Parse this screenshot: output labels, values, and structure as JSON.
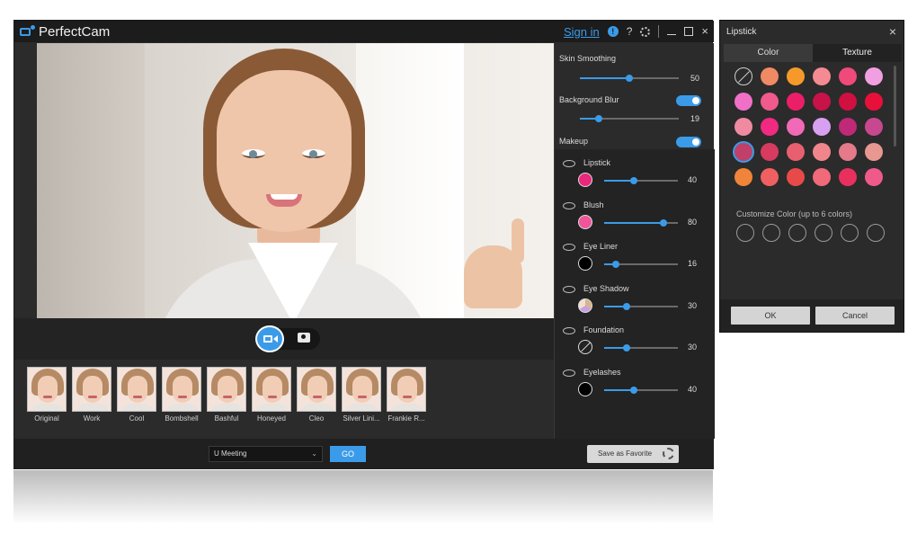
{
  "app": {
    "name": "PerfectCam",
    "signin_label": "Sign in",
    "help_label": "?",
    "close_label": "×"
  },
  "settings": {
    "skin_smoothing": {
      "label": "Skin Smoothing",
      "value": "50",
      "level": 50
    },
    "background_blur": {
      "label": "Background Blur",
      "value": "19",
      "level": 19,
      "enabled": true
    },
    "makeup": {
      "label": "Makeup",
      "enabled": true
    }
  },
  "makeup_items": [
    {
      "label": "Lipstick",
      "value": "40",
      "level": 40,
      "color": "#e8287a",
      "icon": "lips-icon"
    },
    {
      "label": "Blush",
      "value": "80",
      "level": 80,
      "color": "#f0559a",
      "icon": "brush-icon"
    },
    {
      "label": "Eye Liner",
      "value": "16",
      "level": 16,
      "color": "#000000",
      "icon": "eye-icon"
    },
    {
      "label": "Eye Shadow",
      "value": "30",
      "level": 30,
      "color": "#d9b38c",
      "icon": "eye-icon"
    },
    {
      "label": "Foundation",
      "value": "30",
      "level": 30,
      "color": "none",
      "icon": "foundation-icon"
    },
    {
      "label": "Eyelashes",
      "value": "40",
      "level": 40,
      "color": "#000000",
      "icon": "eyelash-icon"
    }
  ],
  "presets": [
    {
      "label": "Original"
    },
    {
      "label": "Work"
    },
    {
      "label": "Cool"
    },
    {
      "label": "Bombshell"
    },
    {
      "label": "Bashful"
    },
    {
      "label": "Honeyed"
    },
    {
      "label": "Cleo"
    },
    {
      "label": "Silver Lini..."
    },
    {
      "label": "Frankie R..."
    }
  ],
  "bottom": {
    "meeting_value": "U Meeting",
    "go_label": "GO",
    "favorite_label": "Save as Favorite"
  },
  "lipstick_dialog": {
    "title": "Lipstick",
    "close_label": "×",
    "tab_color": "Color",
    "tab_texture": "Texture",
    "colors": [
      "none",
      "#f08a64",
      "#f59a2a",
      "#f48a92",
      "#ef4a7a",
      "#f0a0e0",
      "#f070c8",
      "#f05a8c",
      "#ec1e68",
      "#c8124a",
      "#d01040",
      "#e8103a",
      "#f08aa0",
      "#f02a80",
      "#f06ab8",
      "#d8a0f0",
      "#c02878",
      "#c84890",
      "#c0406a",
      "#d83a60",
      "#e86070",
      "#f0868c",
      "#e47a8a",
      "#e89890",
      "#f0843a",
      "#f06060",
      "#e84a4a",
      "#f06a7a",
      "#e8305e",
      "#f05a8a"
    ],
    "selected_index": 18,
    "customize_label": "Customize Color (up to 6 colors)",
    "ok_label": "OK",
    "cancel_label": "Cancel"
  },
  "accent_color": "#3b9be8"
}
